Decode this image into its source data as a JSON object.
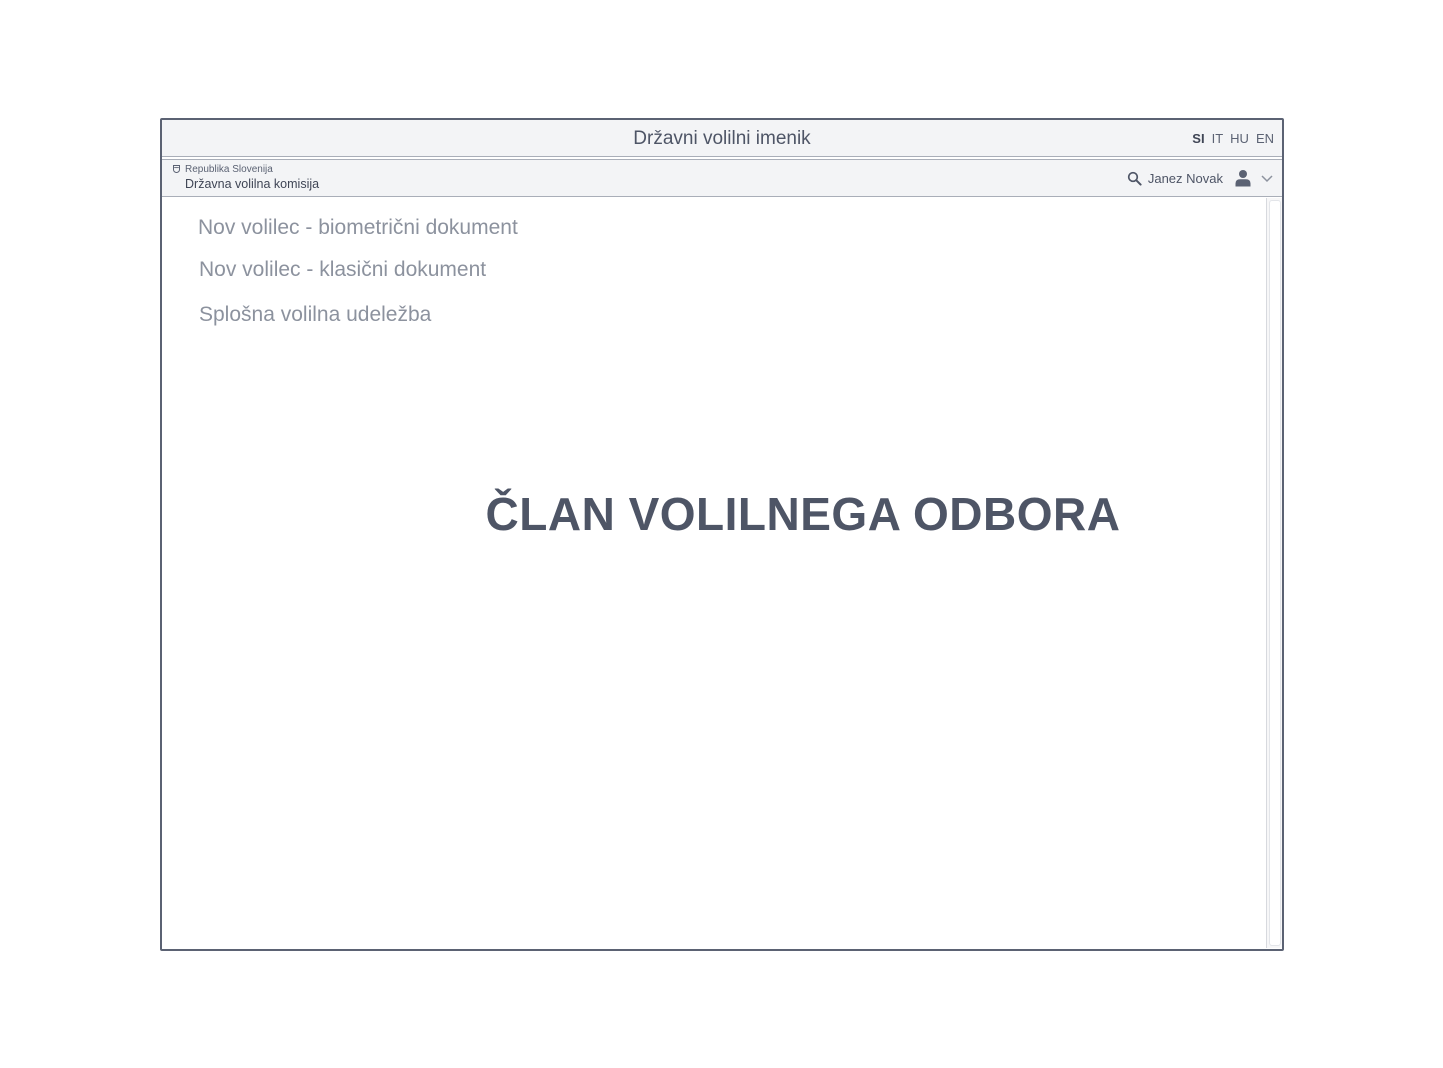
{
  "window": {
    "title": "Državni volilni imenik",
    "languages": [
      {
        "code": "SI",
        "active": true
      },
      {
        "code": "IT",
        "active": false
      },
      {
        "code": "HU",
        "active": false
      },
      {
        "code": "EN",
        "active": false
      }
    ]
  },
  "header": {
    "org_top": "Republika Slovenija",
    "org_main": "Državna volilna komisija",
    "user_name": "Janez Novak",
    "icons": [
      "crest-icon",
      "search-icon",
      "user-icon",
      "chevron-down-icon"
    ]
  },
  "menu": {
    "items": [
      {
        "label": "Nov volilec - biometrični dokument"
      },
      {
        "label": "Nov volilec - klasični dokument"
      },
      {
        "label": "Splošna volilna udeležba"
      }
    ]
  },
  "main": {
    "role_heading": "ČLAN VOLILNEGA ODBORA"
  },
  "colors": {
    "frame": "#5b6273",
    "bar_background": "#f3f4f6",
    "text_primary": "#4e5566",
    "text_muted": "#8c929e"
  }
}
